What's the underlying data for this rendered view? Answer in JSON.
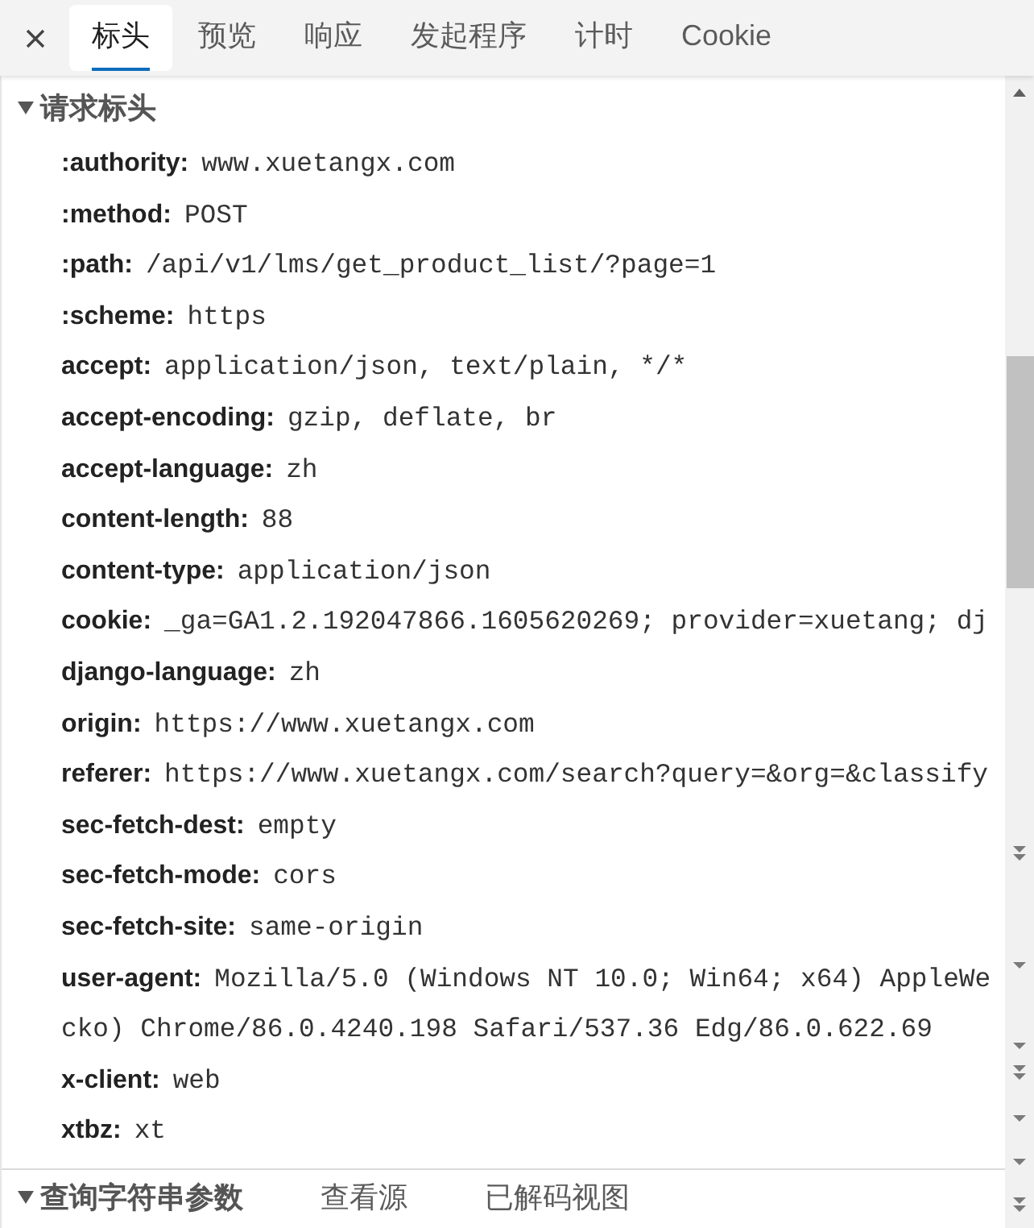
{
  "tabs": [
    {
      "label": "标头",
      "selected": true
    },
    {
      "label": "预览",
      "selected": false
    },
    {
      "label": "响应",
      "selected": false
    },
    {
      "label": "发起程序",
      "selected": false
    },
    {
      "label": "计时",
      "selected": false
    },
    {
      "label": "Cookie",
      "selected": false
    }
  ],
  "request_headers": {
    "title": "请求标头",
    "expanded": true,
    "headers": [
      {
        "name": ":authority:",
        "value": "www.xuetangx.com"
      },
      {
        "name": ":method:",
        "value": "POST"
      },
      {
        "name": ":path:",
        "value": "/api/v1/lms/get_product_list/?page=1"
      },
      {
        "name": ":scheme:",
        "value": "https"
      },
      {
        "name": "accept:",
        "value": "application/json, text/plain, */*"
      },
      {
        "name": "accept-encoding:",
        "value": "gzip, deflate, br"
      },
      {
        "name": "accept-language:",
        "value": "zh"
      },
      {
        "name": "content-length:",
        "value": "88"
      },
      {
        "name": "content-type:",
        "value": "application/json"
      },
      {
        "name": "cookie:",
        "value": "_ga=GA1.2.192047866.1605620269; provider=xuetang; dj"
      },
      {
        "name": "django-language:",
        "value": "zh"
      },
      {
        "name": "origin:",
        "value": "https://www.xuetangx.com"
      },
      {
        "name": "referer:",
        "value": "https://www.xuetangx.com/search?query=&org=&classify"
      },
      {
        "name": "sec-fetch-dest:",
        "value": "empty"
      },
      {
        "name": "sec-fetch-mode:",
        "value": "cors"
      },
      {
        "name": "sec-fetch-site:",
        "value": "same-origin"
      },
      {
        "name": "user-agent:",
        "value": "Mozilla/5.0 (Windows NT 10.0; Win64; x64) AppleWe",
        "continuation": "cko) Chrome/86.0.4240.198 Safari/537.36 Edg/86.0.622.69"
      },
      {
        "name": "x-client:",
        "value": "web"
      },
      {
        "name": "xtbz:",
        "value": "xt"
      }
    ]
  },
  "query_string_parameters": {
    "title": "查询字符串参数",
    "expanded": true,
    "links": [
      "查看源",
      "已解码视图"
    ]
  }
}
